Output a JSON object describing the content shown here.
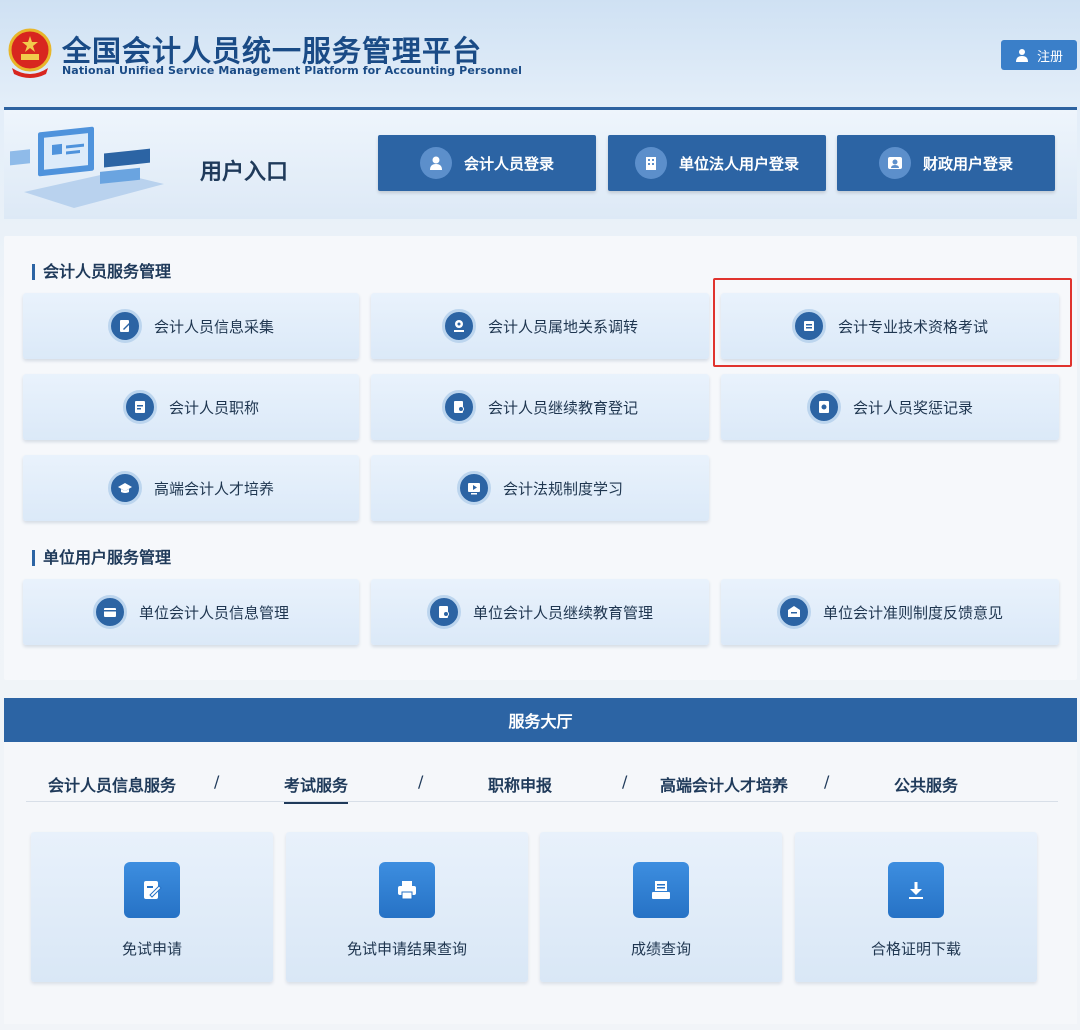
{
  "header": {
    "title_cn": "全国会计人员统一服务管理平台",
    "title_en": "National Unified Service Management Platform for Accounting Personnel",
    "register_label": "注册"
  },
  "entry": {
    "title": "用户入口",
    "buttons": [
      {
        "label": "会计人员登录",
        "icon": "person-icon"
      },
      {
        "label": "单位法人用户登录",
        "icon": "building-icon"
      },
      {
        "label": "财政用户登录",
        "icon": "id-card-icon"
      }
    ]
  },
  "accountant_section": {
    "title": "会计人员服务管理",
    "items": [
      {
        "label": "会计人员信息采集",
        "icon": "edit-doc-icon"
      },
      {
        "label": "会计人员属地关系调转",
        "icon": "location-icon"
      },
      {
        "label": "会计专业技术资格考试",
        "icon": "exam-icon"
      },
      {
        "label": "会计人员职称",
        "icon": "title-doc-icon"
      },
      {
        "label": "会计人员继续教育登记",
        "icon": "search-doc-icon"
      },
      {
        "label": "会计人员奖惩记录",
        "icon": "record-icon"
      },
      {
        "label": "高端会计人才培养",
        "icon": "graduation-cap-icon"
      },
      {
        "label": "会计法规制度学习",
        "icon": "video-icon"
      }
    ]
  },
  "unit_section": {
    "title": "单位用户服务管理",
    "items": [
      {
        "label": "单位会计人员信息管理",
        "icon": "card-icon"
      },
      {
        "label": "单位会计人员继续教育管理",
        "icon": "search-doc-icon"
      },
      {
        "label": "单位会计准则制度反馈意见",
        "icon": "feedback-icon"
      }
    ]
  },
  "hall": {
    "title": "服务大厅",
    "tabs": [
      "会计人员信息服务",
      "考试服务",
      "职称申报",
      "高端会计人才培养",
      "公共服务"
    ],
    "separator": "/",
    "active_tab": "考试服务",
    "services": [
      {
        "label": "免试申请",
        "icon": "edit-icon"
      },
      {
        "label": "免试申请结果查询",
        "icon": "printer-icon"
      },
      {
        "label": "成绩查询",
        "icon": "score-icon"
      },
      {
        "label": "合格证明下载",
        "icon": "download-icon"
      }
    ]
  },
  "colors": {
    "primary": "#2c64a4",
    "highlight": "#e0332e",
    "accent": "#3a7fc9"
  }
}
